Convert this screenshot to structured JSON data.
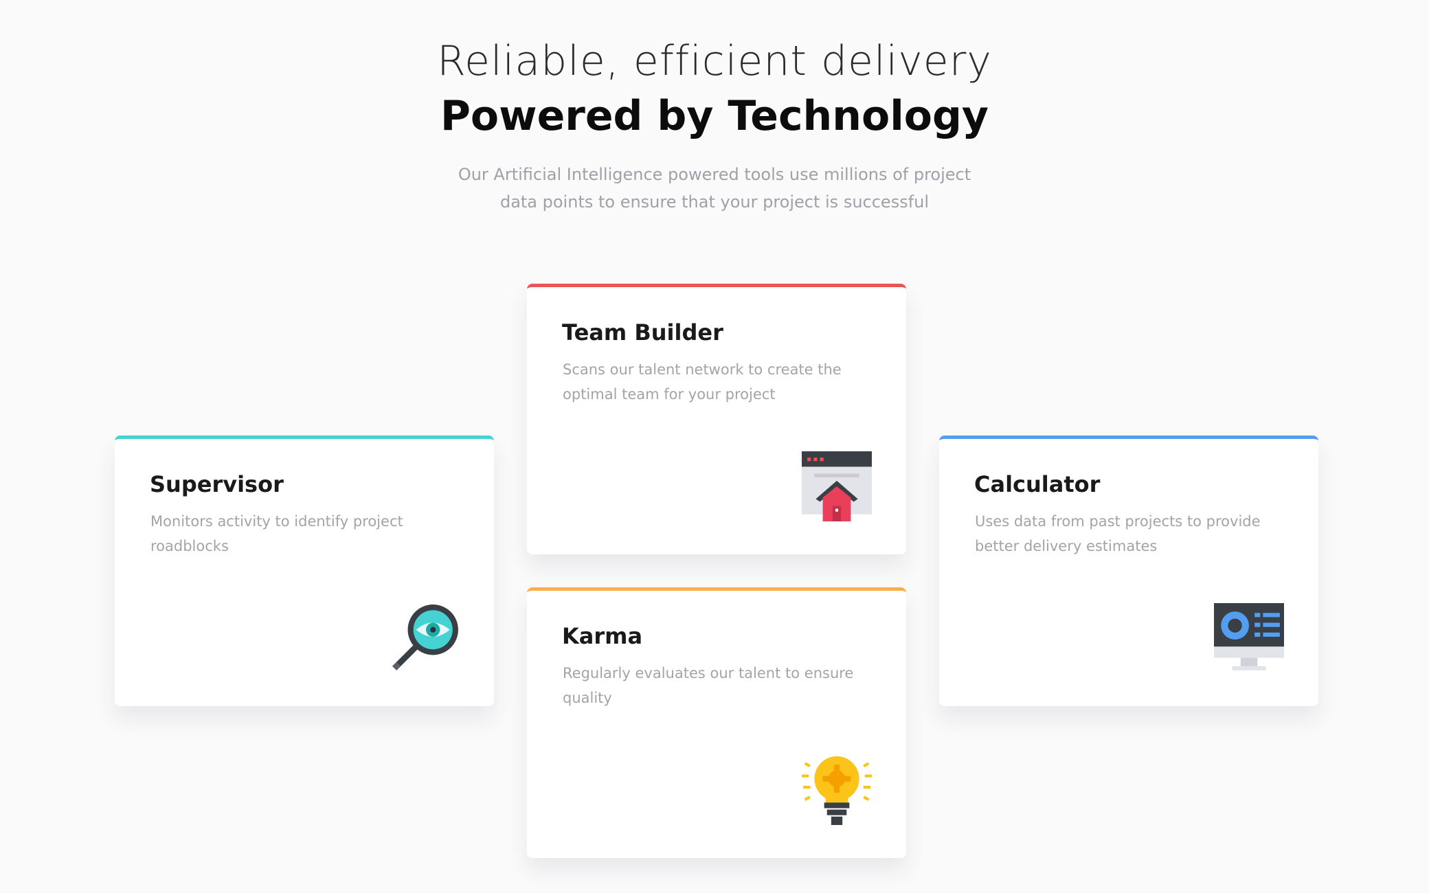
{
  "header": {
    "light_title": "Reliable, efficient delivery",
    "bold_title": "Powered by Technology",
    "description": "Our Artificial Intelligence powered tools use millions of project data points to ensure that your project is successful"
  },
  "cards": {
    "supervisor": {
      "title": "Supervisor",
      "description": "Monitors activity to identify project roadblocks",
      "accent_color": "#44d3d2",
      "icon": "magnifier-eye-icon"
    },
    "team_builder": {
      "title": "Team Builder",
      "description": "Scans our talent network to create the optimal team for your project",
      "accent_color": "#ea5454",
      "icon": "window-house-icon"
    },
    "karma": {
      "title": "Karma",
      "description": "Regularly evaluates our talent to ensure quality",
      "accent_color": "#fcae4a",
      "icon": "lightbulb-icon"
    },
    "calculator": {
      "title": "Calculator",
      "description": "Uses data from past projects to provide better delivery estimates",
      "accent_color": "#549ef2",
      "icon": "monitor-chart-icon"
    }
  }
}
